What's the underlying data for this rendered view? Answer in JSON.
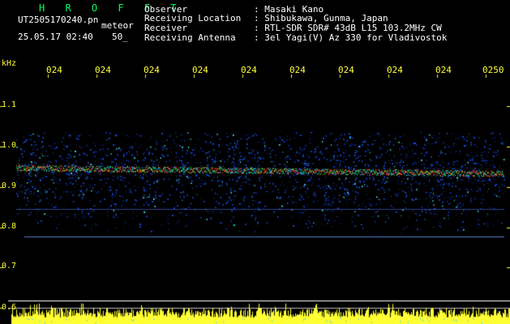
{
  "header": {
    "title": "H R O F F T",
    "filename": "UT2505170240.pn",
    "mode": "meteor",
    "datetime": "25.05.17 02:40",
    "count": "50_",
    "info_labels": [
      "Observer",
      "Receiving Location",
      "Receiver",
      "Receiving Antenna"
    ],
    "info_values": [
      ": Masaki Kano",
      ": Shibukawa, Gunma, Japan",
      ": RTL-SDR SDR# 43dB L15 103.2MHz CW",
      ": 3el Yagi(V) Az 330 for Vladivostok"
    ]
  },
  "time_axis": {
    "ticks": [
      "024",
      "024",
      "024",
      "024",
      "024",
      "024",
      "024",
      "024",
      "024",
      "0250"
    ]
  },
  "freq_axis": {
    "unit": "kHz",
    "ticks": [
      "1.1",
      "1.0",
      "0.9",
      "0.8",
      "0.7",
      "0.6"
    ]
  },
  "colors": {
    "background": "#000000",
    "title": "#00ff66",
    "text": "#ffffff",
    "axis_text": "#ffff33",
    "noise": "#1e3cff",
    "signal": "#ff3030",
    "level_bar": "#ffff33"
  }
}
